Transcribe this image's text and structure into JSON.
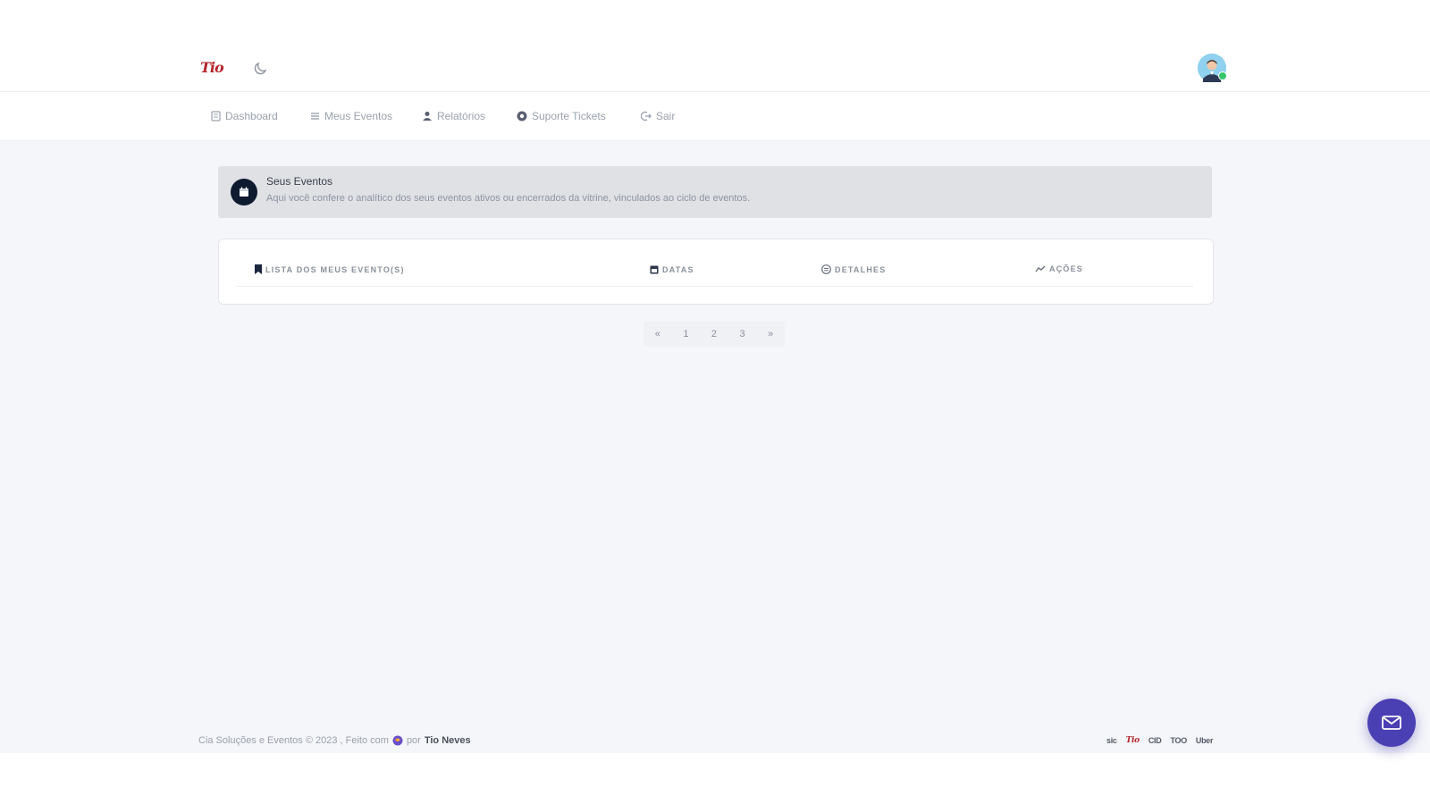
{
  "header": {
    "logo_text": "Tio",
    "theme_toggle_icon": "moon-icon",
    "avatar_icon": "user-avatar"
  },
  "nav": {
    "items": [
      {
        "label": "Dashboard",
        "icon": "dashboard-icon"
      },
      {
        "label": "Meus Eventos",
        "icon": "list-icon"
      },
      {
        "label": "Relatórios",
        "icon": "report-icon"
      },
      {
        "label": "Suporte Tickets",
        "icon": "support-icon"
      },
      {
        "label": "Sair",
        "icon": "logout-icon"
      }
    ]
  },
  "banner": {
    "title": "Seus Eventos",
    "text": "Aqui você confere o analítico dos seus eventos ativos ou encerrados da vitrine, vinculados ao ciclo de eventos."
  },
  "table": {
    "headers": [
      {
        "label": "LISTA DOS MEUS EVENTO(S)",
        "icon": "bookmark-icon"
      },
      {
        "label": "DATAS",
        "icon": "calendar-icon"
      },
      {
        "label": "DETALHES",
        "icon": "details-icon"
      },
      {
        "label": "AÇÕES",
        "icon": "actions-icon"
      }
    ],
    "rows": []
  },
  "pagination": {
    "prev": "«",
    "pages": [
      "1",
      "2",
      "3"
    ],
    "next": "»"
  },
  "footer": {
    "text_prefix": "Cia Soluções e Eventos © 2023 , Feito com",
    "text_by": "por",
    "author": "Tio Neves",
    "partners": [
      "sic",
      "Tio",
      "CID",
      "TOO",
      "Uber"
    ]
  },
  "colors": {
    "brand_red": "#b3262c",
    "fab": "#4a3fb3",
    "page_bg": "#f5f6fa"
  }
}
